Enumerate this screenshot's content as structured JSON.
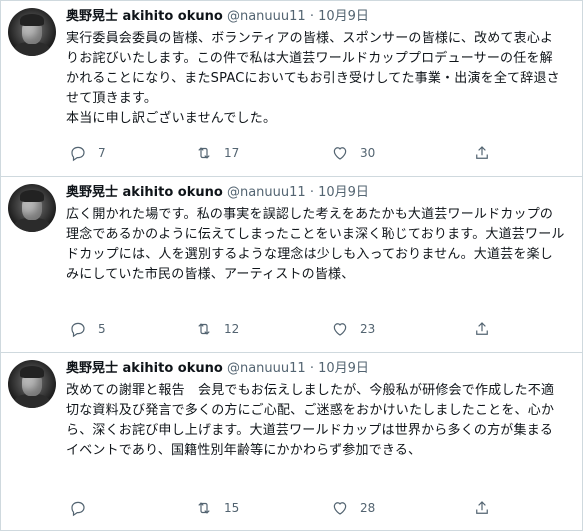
{
  "tweets": [
    {
      "name": "奥野晃士 akihito okuno",
      "handle": "@nanuuu11",
      "dot": "·",
      "date": "10月9日",
      "text": "実行委員会委員の皆様、ボランティアの皆様、スポンサーの皆様に、改めて衷心よりお詫びいたします。この件で私は大道芸ワールドカッププロデューサーの任を解かれることになり、またSPACにおいてもお引き受けしてた事業・出演を全て辞退させて頂きます。\n本当に申し訳ございませんでした。",
      "replies": "7",
      "retweets": "17",
      "likes": "30"
    },
    {
      "name": "奥野晃士 akihito okuno",
      "handle": "@nanuuu11",
      "dot": "·",
      "date": "10月9日",
      "text": "広く開かれた場です。私の事実を誤認した考えをあたかも大道芸ワールドカップの理念であるかのように伝えてしまったことをいま深く恥じております。大道芸ワールドカップには、人を選別するような理念は少しも入っておりません。大道芸を楽しみにしていた市民の皆様、アーティストの皆様、",
      "replies": "5",
      "retweets": "12",
      "likes": "23"
    },
    {
      "name": "奥野晃士 akihito okuno",
      "handle": "@nanuuu11",
      "dot": "·",
      "date": "10月9日",
      "text": "改めての謝罪と報告　会見でもお伝えしましたが、今般私が研修会で作成した不適切な資料及び発言で多くの方にご心配、ご迷惑をおかけいたしましたことを、心から、深くお詫び申し上げます。大道芸ワールドカップは世界から多くの方が集まるイベントであり、国籍性別年齢等にかかわらず参加できる、",
      "replies": "",
      "retweets": "15",
      "likes": "28"
    }
  ],
  "icons": {
    "reply": "reply-icon",
    "retweet": "retweet-icon",
    "like": "heart-icon",
    "share": "share-icon"
  },
  "colors": {
    "text": "#0f1419",
    "secondary": "#536471",
    "border": "#cfd9de"
  }
}
